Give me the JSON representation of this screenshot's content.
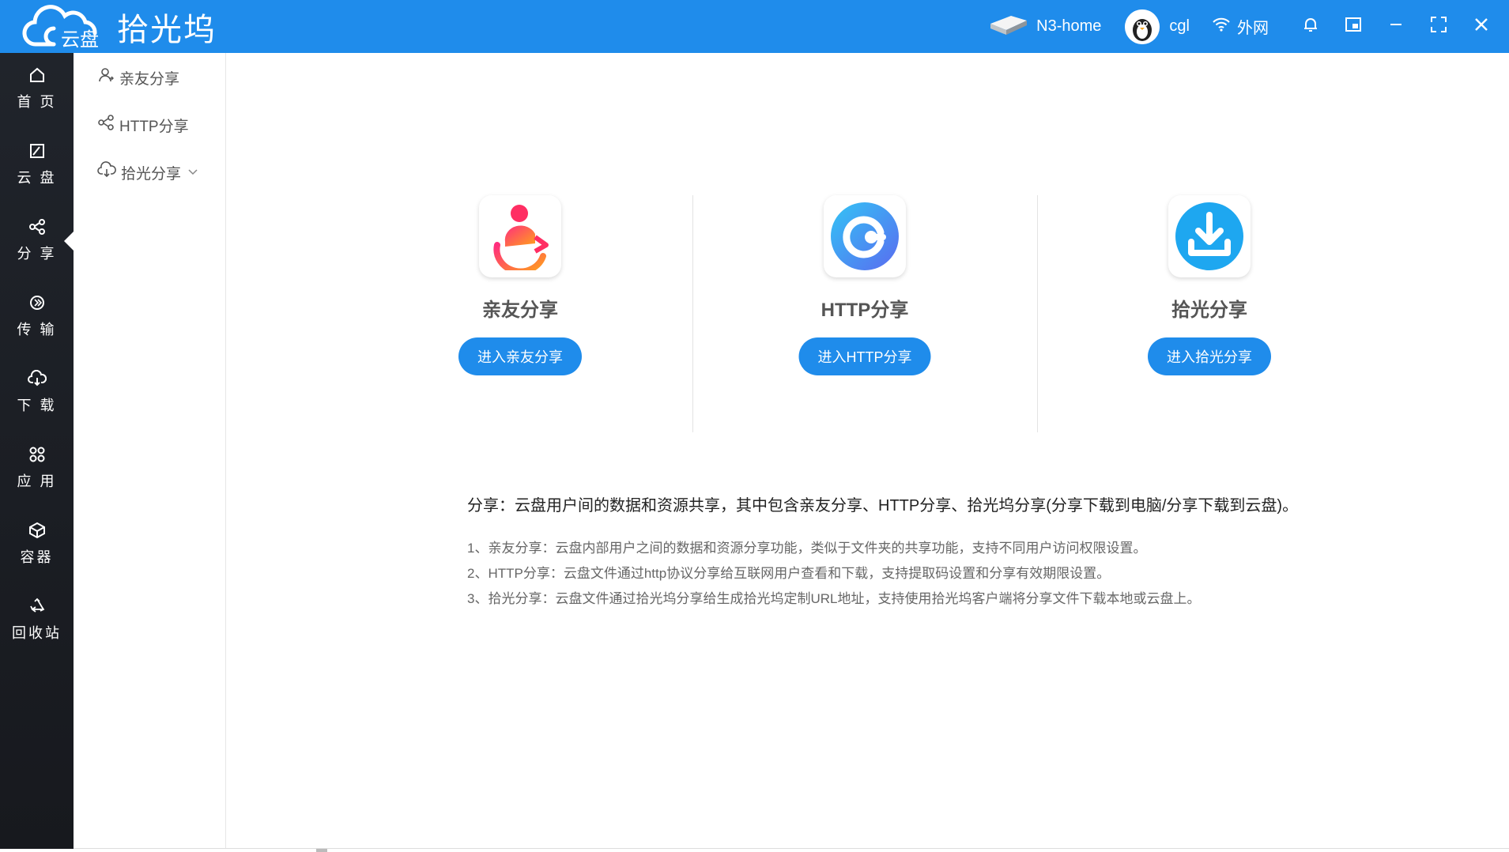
{
  "app": {
    "cloud_text": "云盘",
    "title": "拾光坞"
  },
  "topbar": {
    "device_name": "N3-home",
    "user_name": "cgl",
    "network_label": "外网",
    "accent_color": "#1f8ceb"
  },
  "leftnav": {
    "items": [
      {
        "label": "首 页",
        "icon": "home-icon"
      },
      {
        "label": "云 盘",
        "icon": "cloud-disk-icon"
      },
      {
        "label": "分 享",
        "icon": "share-icon",
        "active": true
      },
      {
        "label": "传 输",
        "icon": "transfer-icon"
      },
      {
        "label": "下 载",
        "icon": "download-icon"
      },
      {
        "label": "应 用",
        "icon": "apps-icon"
      },
      {
        "label": "容器",
        "icon": "container-icon"
      },
      {
        "label": "回收站",
        "icon": "recycle-icon"
      }
    ]
  },
  "submenu": {
    "items": [
      {
        "label": "亲友分享",
        "icon": "user-icon"
      },
      {
        "label": "HTTP分享",
        "icon": "share-icon"
      },
      {
        "label": "拾光分享",
        "icon": "cloud-download-icon",
        "expandable": true
      }
    ]
  },
  "cards": [
    {
      "title": "亲友分享",
      "button": "进入亲友分享",
      "icon": "friend-share-icon"
    },
    {
      "title": "HTTP分享",
      "button": "进入HTTP分享",
      "icon": "http-share-icon"
    },
    {
      "title": "拾光分享",
      "button": "进入拾光分享",
      "icon": "shiguang-share-icon"
    }
  ],
  "description": {
    "main": "分享：云盘用户间的数据和资源共享，其中包含亲友分享、HTTP分享、拾光坞分享(分享下载到电脑/分享下载到云盘)。",
    "lines": [
      "1、亲友分享：云盘内部用户之间的数据和资源分享功能，类似于文件夹的共享功能，支持不同用户访问权限设置。",
      "2、HTTP分享：云盘文件通过http协议分享给互联网用户查看和下载，支持提取码设置和分享有效期限设置。",
      "3、拾光分享：云盘文件通过拾光坞分享给生成拾光坞定制URL地址，支持使用拾光坞客户端将分享文件下载本地或云盘上。"
    ]
  }
}
